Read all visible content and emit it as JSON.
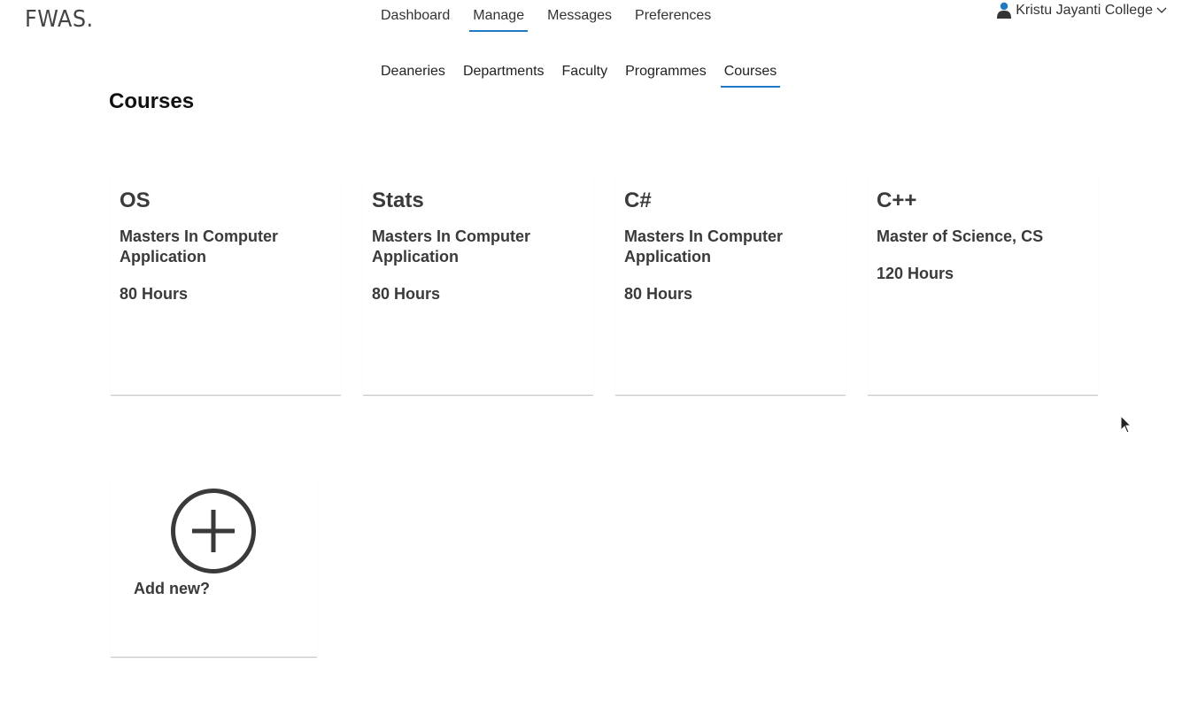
{
  "brand": {
    "logo_text": "FWAS."
  },
  "primary_nav": {
    "items": [
      {
        "label": "Dashboard",
        "active": false
      },
      {
        "label": "Manage",
        "active": true
      },
      {
        "label": "Messages",
        "active": false
      },
      {
        "label": "Preferences",
        "active": false
      }
    ]
  },
  "user_menu": {
    "name": "Kristu Jayanti College",
    "icon": "user-icon",
    "caret": "chevron-down-icon"
  },
  "secondary_nav": {
    "items": [
      {
        "label": "Deaneries",
        "active": false
      },
      {
        "label": "Departments",
        "active": false
      },
      {
        "label": "Faculty",
        "active": false
      },
      {
        "label": "Programmes",
        "active": false
      },
      {
        "label": "Courses",
        "active": true
      }
    ]
  },
  "page": {
    "title": "Courses"
  },
  "courses": [
    {
      "name": "OS",
      "programme": "Masters In Computer Application",
      "hours": "80 Hours"
    },
    {
      "name": "Stats",
      "programme": "Masters In Computer Application",
      "hours": "80 Hours"
    },
    {
      "name": "C#",
      "programme": "Masters In Computer Application",
      "hours": "80 Hours"
    },
    {
      "name": "C++",
      "programme": "Master of Science, CS",
      "hours": "120 Hours"
    }
  ],
  "add_new": {
    "label": "Add new?",
    "icon": "plus-circle-icon"
  },
  "colors": {
    "accent": "#1e7ac7",
    "card_text": "#3a3a3a"
  }
}
